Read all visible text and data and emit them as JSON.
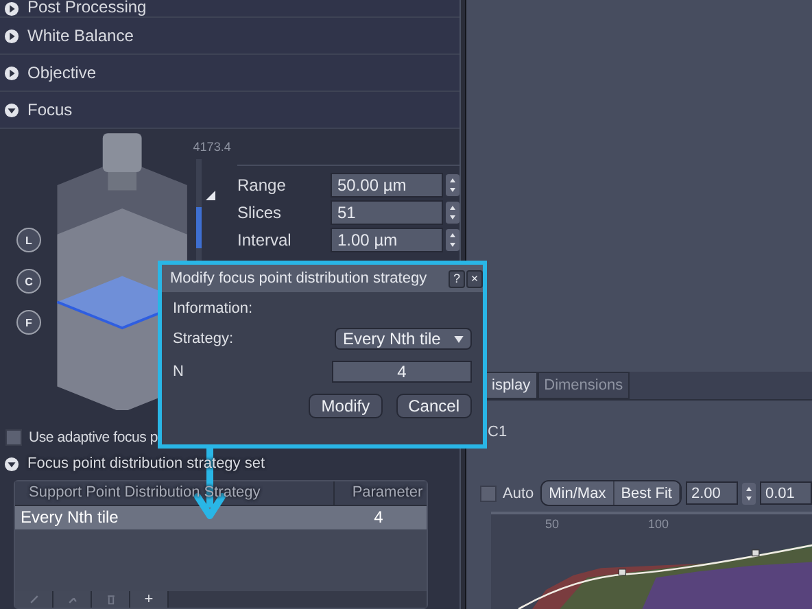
{
  "sections": [
    {
      "label": "Post Processing",
      "expanded": false
    },
    {
      "label": "White Balance",
      "expanded": false
    },
    {
      "label": "Objective",
      "expanded": false
    },
    {
      "label": "Focus",
      "expanded": true
    }
  ],
  "focus": {
    "position_markers": [
      "L",
      "C",
      "F"
    ],
    "scale_reading": "4173.4",
    "fields": [
      {
        "label": "Range",
        "value": "50.00 µm"
      },
      {
        "label": "Slices",
        "value": "51"
      },
      {
        "label": "Interval",
        "value": "1.00 µm"
      }
    ]
  },
  "adaptive_focus": {
    "label": "Use adaptive focus p",
    "checked": false
  },
  "strategy_set": {
    "label": "Focus point distribution strategy set",
    "expanded": true,
    "columns": [
      "Support Point Distribution Strategy",
      "Parameter"
    ],
    "rows": [
      {
        "strategy": "Every Nth tile",
        "parameter": "4",
        "selected": true
      }
    ],
    "toolbar": [
      {
        "kind": "edit",
        "disabled": true
      },
      {
        "kind": "move",
        "disabled": true
      },
      {
        "kind": "delete",
        "disabled": true
      },
      {
        "kind": "add",
        "label": "+",
        "disabled": false
      }
    ]
  },
  "dialog": {
    "title": "Modify focus point distribution strategy",
    "help": "?",
    "close": "×",
    "info_label": "Information:",
    "strategy_label": "Strategy:",
    "strategy_value": "Every Nth tile",
    "n_label": "N",
    "n_value": "4",
    "buttons": [
      "Modify",
      "Cancel"
    ]
  },
  "view": {
    "tabs": [
      {
        "label": "isplay",
        "selected": true
      },
      {
        "label": "Dimensions",
        "selected": false
      }
    ],
    "channel": "C1",
    "auto": {
      "label": "Auto",
      "checked": false
    },
    "range_buttons": [
      "Min/Max",
      "Best Fit"
    ],
    "gamma": "2.00",
    "field_2": "0.01",
    "histogram_ticks": [
      "50",
      "100"
    ]
  }
}
